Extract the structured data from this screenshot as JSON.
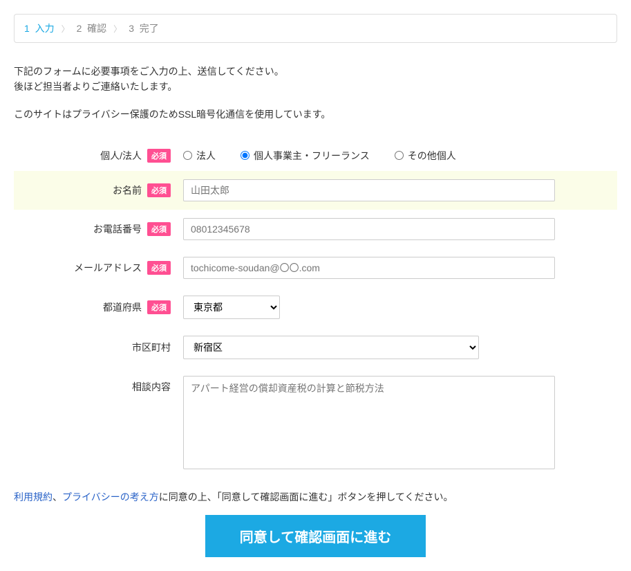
{
  "breadcrumb": {
    "step1_num": "1",
    "step1_label": "入力",
    "step2_num": "2",
    "step2_label": "確認",
    "step3_num": "3",
    "step3_label": "完了"
  },
  "intro": {
    "line1": "下記のフォームに必要事項をご入力の上、送信してください。",
    "line2": "後ほど担当者よりご連絡いたします。"
  },
  "ssl_note": "このサイトはプライバシー保護のためSSL暗号化通信を使用しています。",
  "required_badge": "必須",
  "fields": {
    "entity_type": {
      "label": "個人/法人",
      "options": {
        "corp": "法人",
        "sole": "個人事業主・フリーランス",
        "other": "その他個人"
      },
      "selected": "sole"
    },
    "name": {
      "label": "お名前",
      "placeholder": "山田太郎",
      "value": ""
    },
    "phone": {
      "label": "お電話番号",
      "placeholder": "08012345678",
      "value": ""
    },
    "email": {
      "label": "メールアドレス",
      "placeholder": "tochicome-soudan@〇〇.com",
      "value": ""
    },
    "prefecture": {
      "label": "都道府県",
      "selected": "東京都"
    },
    "city": {
      "label": "市区町村",
      "selected": "新宿区"
    },
    "inquiry": {
      "label": "相談内容",
      "placeholder": "アパート経営の償却資産税の計算と節税方法",
      "value": ""
    }
  },
  "terms": {
    "link_tos": "利用規約",
    "sep": "、",
    "link_privacy": "プライバシーの考え方",
    "tail": "に同意の上、「同意して確認画面に進む」ボタンを押してください。"
  },
  "submit_label": "同意して確認画面に進む"
}
